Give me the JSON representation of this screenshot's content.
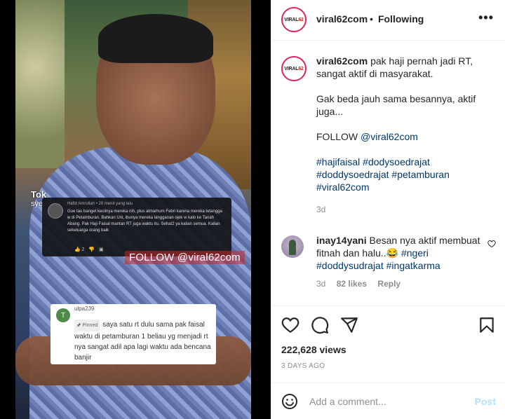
{
  "media": {
    "tiktok_label": "Tok",
    "tiktok_user": "syeuxdenetizen",
    "dark_comment": {
      "user": "Hafid Amrullah",
      "time": "29 menit yang lalu",
      "text": "Gue tau banget kecilnya mereka nih, plus almarhum Febri karena mereka tetangga w di Petamburan. Bahkan Uni, ibunya mereka langganan ojek w kalo ke Tanah Abang. Pak Haji Faisal mantan RT juga waktu itu. Sehat2 ya kalian semua. Kalian sekeluarga orang baik",
      "likes": "2"
    },
    "watermark": "FOLLOW @viral62com",
    "white_comment": {
      "avatar_letter": "T",
      "user": "ulpa239",
      "pinned": "Pinned",
      "text": "saya satu rt dulu sama pak faisal waktu di petamburan 1 beliau yg menjadi rt nya sangat adil apa lagi waktu ada bencana banjir"
    }
  },
  "header": {
    "logo_text": "VIRAL",
    "logo_accent": "62",
    "username": "viral62com",
    "dot": "•",
    "follow": "Following",
    "more": "•••"
  },
  "caption": {
    "username": "viral62com",
    "line1": "pak haji pernah jadi RT, sangat aktif di masyarakat.",
    "line2": "Gak beda jauh sama besannya, aktif juga...",
    "follow_prefix": "FOLLOW ",
    "follow_link": "@viral62com",
    "hashtags": [
      "#hajifaisal",
      "#dodysoedrajat",
      "#doddysoedrajat",
      "#petamburan",
      "#viral62com"
    ],
    "time": "3d"
  },
  "reply": {
    "username": "inay14yani",
    "text": "Besan nya aktif membuat fitnah dan halu..",
    "emoji": "😂",
    "hashtags": [
      "#ngeri",
      "#doddysudrajat",
      "#ingatkarma"
    ],
    "time": "3d",
    "likes": "82 likes",
    "reply_label": "Reply"
  },
  "stats": {
    "views": "222,628 views",
    "ago": "3 DAYS AGO"
  },
  "add_comment": {
    "placeholder": "Add a comment...",
    "post": "Post"
  },
  "colors": {
    "link": "#00376b",
    "muted": "#8e8e8e",
    "post_disabled": "#b2dffc",
    "logo_ring": "#e0245e"
  }
}
